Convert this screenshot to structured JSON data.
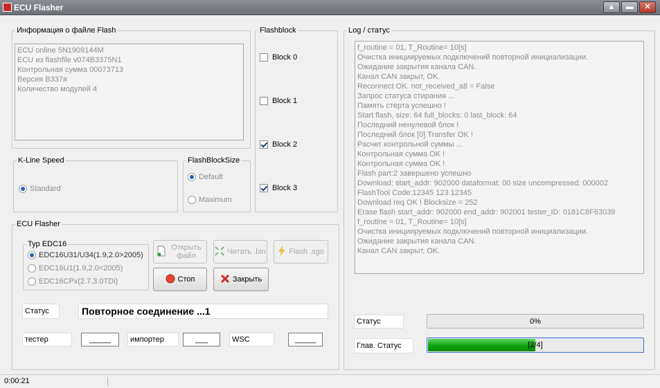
{
  "window": {
    "title": "ECU Flasher"
  },
  "file_info": {
    "legend": "Информация  о файле Flash",
    "lines": [
      "ECU online 5N1909144M",
      "ECU из flashfile v074B3375N1",
      "Контрольная сумма 00073713",
      "Версия B337я",
      "Количество модулей 4"
    ]
  },
  "flashblock": {
    "legend": "Flashblock",
    "blocks": [
      {
        "label": "Block 0",
        "checked": false
      },
      {
        "label": "Block 1",
        "checked": false
      },
      {
        "label": "Block 2",
        "checked": true
      },
      {
        "label": "Block 3",
        "checked": true
      }
    ]
  },
  "kline": {
    "legend": "K-Line Speed",
    "option": "Standard"
  },
  "flashblocksize": {
    "legend": "FlashBlockSize",
    "options": [
      "Default",
      "Maximum"
    ]
  },
  "ecu_flasher": {
    "legend": "ECU Flasher",
    "typ_legend": "Typ EDC16",
    "types": [
      "EDC16U31/U34(1.9,2.0>2005)",
      "EDC16U1(1.9,2.0<2005)",
      "EDC16CPx(2.7,3.0TDi)"
    ],
    "buttons": {
      "open_file": "Открыть файл",
      "read_bin": "Читать .bin",
      "flash_sgo": "Flash .sgo",
      "stop": "Стоп",
      "close": "Закрыть"
    },
    "status_label": "Статус",
    "status_value": "Повторное соединение ...1",
    "tester_label": "тестер",
    "tester_value": "_____",
    "importer_label": "импортер",
    "importer_value": "___",
    "wsc_label": "WSC",
    "wsc_value": "_____"
  },
  "log": {
    "legend": "Log / статус",
    "lines": [
      "f_routine = 01, T_Routine= 10[s]",
      "Очистка инициируемых подключений повторной инициализации.",
      "Ожидание закрытия канала CAN.",
      "Канал CAN закрыт, OK.",
      "Reconnect OK. not_received_a8 = False",
      "Запрос статуса стирания ...",
      "Память стерта успешно !",
      "Start flash, size: 64 full_blocks: 0 last_block: 64",
      "Последний ненулевой блок !",
      "Последний блок [0] Transfer OK !",
      "Расчет контрольной суммы ...",
      "Контрольная сумма OK !",
      "Контрольная сумма OK !",
      "Flash part:2 завершено успешно",
      "Download: start_addr: 902000 dataformat: 00 size uncompressed: 000002",
      "FlashTool Code:12345 123 12345",
      "Download req OK ! Blocksize = 252",
      "Erase flash start_addr: 902000 end_addr: 902001 tester_ID: 0181C8F63039",
      "f_routine = 01, T_Routine= 10[s]",
      "Очистка инициируемых подключений повторной инициализации.",
      "Ожидание закрытия канала CAN.",
      "Канал CAN закрыт, OK."
    ],
    "status_label": "Статус",
    "status_text": "0%",
    "status_fraction": 0,
    "main_status_label": "Глав. Статус",
    "main_status_text": "[2/4]",
    "main_status_fraction": 0.5
  },
  "statusbar": {
    "time": "0:00:21"
  }
}
